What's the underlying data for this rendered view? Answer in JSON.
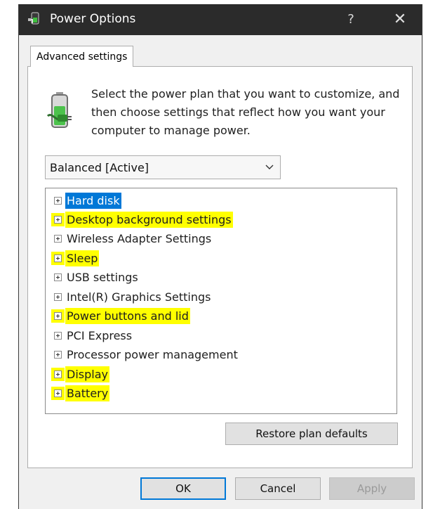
{
  "window": {
    "title": "Power Options",
    "help_label": "?",
    "close_label": "✕"
  },
  "tab": {
    "label": "Advanced settings"
  },
  "description": "Select the power plan that you want to customize, and then choose settings that reflect how you want your computer to manage power.",
  "plan_select": {
    "value": "Balanced [Active]"
  },
  "tree_items": [
    {
      "label": "Hard disk",
      "state": "selected"
    },
    {
      "label": "Desktop background settings",
      "state": "highlighted"
    },
    {
      "label": "Wireless Adapter Settings",
      "state": "normal"
    },
    {
      "label": "Sleep",
      "state": "highlighted"
    },
    {
      "label": "USB settings",
      "state": "normal"
    },
    {
      "label": "Intel(R) Graphics Settings",
      "state": "normal"
    },
    {
      "label": "Power buttons and lid",
      "state": "highlighted"
    },
    {
      "label": "PCI Express",
      "state": "normal"
    },
    {
      "label": "Processor power management",
      "state": "normal"
    },
    {
      "label": "Display",
      "state": "highlighted"
    },
    {
      "label": "Battery",
      "state": "highlighted"
    }
  ],
  "buttons": {
    "restore": "Restore plan defaults",
    "ok": "OK",
    "cancel": "Cancel",
    "apply": "Apply"
  },
  "colors": {
    "titlebar": "#2b2b2b",
    "selection": "#0078d7",
    "highlight": "#ffff00"
  },
  "icons": {
    "window": "power-options-icon",
    "plan": "battery-plug-icon",
    "dropdown": "chevron-down-icon",
    "expander": "plus-box-icon"
  }
}
